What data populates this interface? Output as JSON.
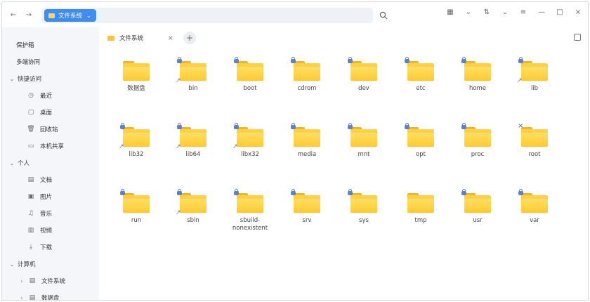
{
  "titlebar": {
    "back_icon": "left-arrow-icon",
    "forward_icon": "right-arrow-icon",
    "breadcrumb_label": "文件系统",
    "breadcrumb_chevron": "⌄",
    "search_icon": "search-icon",
    "toolbar_icons": [
      "grid-icon",
      "chevron-down-icon",
      "sort-icon",
      "chevron-down-icon",
      "list-icon",
      "minimize-icon",
      "maximize-icon",
      "close-icon"
    ],
    "accent": "#3d8df5"
  },
  "sidebar": {
    "items": [
      {
        "label": "保护箱",
        "icon": "",
        "arrow": "",
        "indent": 20
      },
      {
        "label": "多端协同",
        "icon": "",
        "arrow": "",
        "indent": 20
      },
      {
        "label": "快捷访问",
        "icon": "",
        "arrow": "⌄",
        "indent": 8
      },
      {
        "label": "最近",
        "icon": "◷",
        "arrow": "",
        "indent": 34
      },
      {
        "label": "桌面",
        "icon": "▢",
        "arrow": "",
        "indent": 34
      },
      {
        "label": "回收站",
        "icon": "🗑",
        "arrow": "",
        "indent": 34
      },
      {
        "label": "本机共享",
        "icon": "▭",
        "arrow": "",
        "indent": 34
      },
      {
        "label": "个人",
        "icon": "",
        "arrow": "⌄",
        "indent": 8
      },
      {
        "label": "文档",
        "icon": "▤",
        "arrow": "",
        "indent": 34
      },
      {
        "label": "图片",
        "icon": "▣",
        "arrow": "",
        "indent": 34
      },
      {
        "label": "音乐",
        "icon": "♫",
        "arrow": "",
        "indent": 34
      },
      {
        "label": "视频",
        "icon": "▥",
        "arrow": "",
        "indent": 34
      },
      {
        "label": "下载",
        "icon": "⤓",
        "arrow": "",
        "indent": 34
      },
      {
        "label": "计算机",
        "icon": "",
        "arrow": "⌄",
        "indent": 8
      },
      {
        "label": "文件系统",
        "icon": "▤",
        "arrow": "›",
        "indent": 22
      },
      {
        "label": "数据盘",
        "icon": "▤",
        "arrow": "›",
        "indent": 22
      }
    ]
  },
  "tabs": {
    "label": "文件系统",
    "close": "×",
    "add": "+"
  },
  "files": [
    {
      "name": "数据盘",
      "lock": false,
      "link": false,
      "x": false
    },
    {
      "name": "bin",
      "lock": true,
      "link": true,
      "x": false
    },
    {
      "name": "boot",
      "lock": true,
      "link": false,
      "x": false
    },
    {
      "name": "cdrom",
      "lock": true,
      "link": false,
      "x": false
    },
    {
      "name": "dev",
      "lock": true,
      "link": false,
      "x": false
    },
    {
      "name": "etc",
      "lock": true,
      "link": false,
      "x": false
    },
    {
      "name": "home",
      "lock": true,
      "link": false,
      "x": false
    },
    {
      "name": "lib",
      "lock": true,
      "link": true,
      "x": false
    },
    {
      "name": "lib32",
      "lock": true,
      "link": true,
      "x": false
    },
    {
      "name": "lib64",
      "lock": true,
      "link": true,
      "x": false
    },
    {
      "name": "libx32",
      "lock": true,
      "link": true,
      "x": false
    },
    {
      "name": "media",
      "lock": true,
      "link": false,
      "x": false
    },
    {
      "name": "mnt",
      "lock": true,
      "link": false,
      "x": false
    },
    {
      "name": "opt",
      "lock": true,
      "link": false,
      "x": false
    },
    {
      "name": "proc",
      "lock": true,
      "link": false,
      "x": false
    },
    {
      "name": "root",
      "lock": false,
      "link": false,
      "x": true
    },
    {
      "name": "run",
      "lock": true,
      "link": false,
      "x": false
    },
    {
      "name": "sbin",
      "lock": true,
      "link": true,
      "x": false
    },
    {
      "name": "sbuild-nonexistent",
      "lock": true,
      "link": false,
      "x": false
    },
    {
      "name": "srv",
      "lock": true,
      "link": false,
      "x": false
    },
    {
      "name": "sys",
      "lock": true,
      "link": false,
      "x": false
    },
    {
      "name": "tmp",
      "lock": false,
      "link": false,
      "x": false
    },
    {
      "name": "usr",
      "lock": true,
      "link": false,
      "x": false
    },
    {
      "name": "var",
      "lock": true,
      "link": false,
      "x": false
    }
  ]
}
